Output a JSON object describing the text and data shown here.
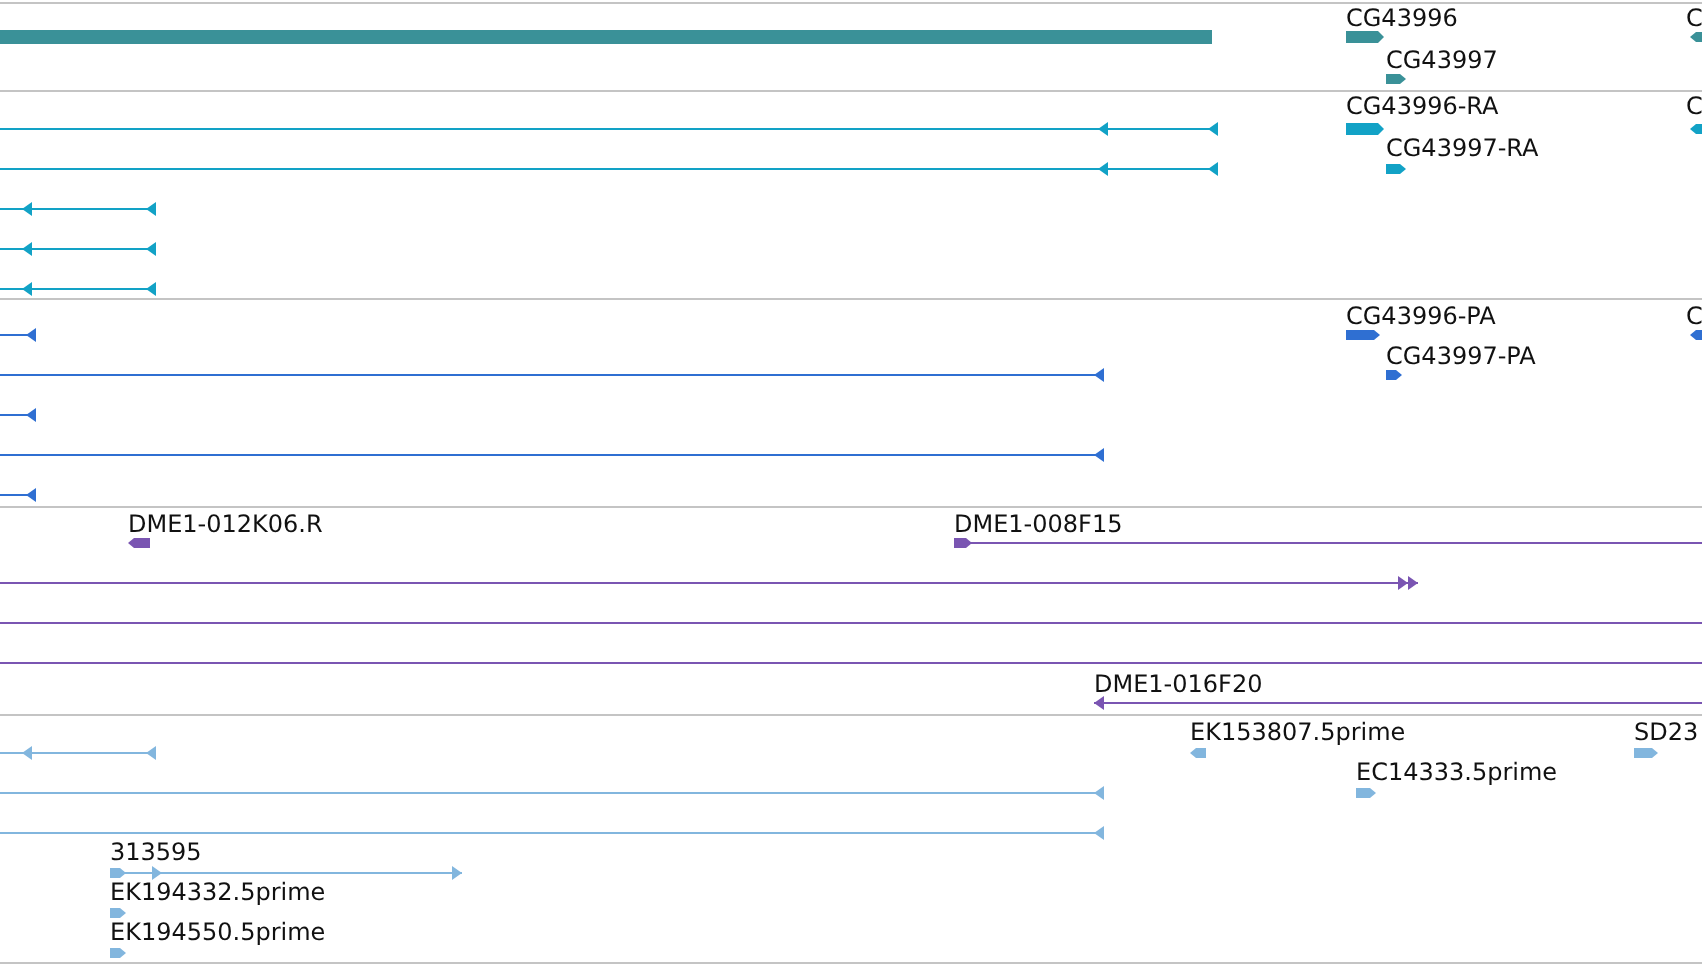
{
  "tracks": [
    {
      "color": "#3a9198",
      "features": [
        {
          "label": "CG43996",
          "kind": "forward"
        },
        {
          "label": "C",
          "kind": "reverse"
        },
        {
          "kind": "plain"
        },
        {
          "label": "CG43997",
          "kind": "forward"
        }
      ]
    },
    {
      "color": "#12a2c6",
      "features": [
        {
          "label": "CG43996-RA",
          "kind": "forward"
        },
        {
          "label": "C",
          "kind": "reverse"
        },
        {
          "kind": "reverse"
        },
        {
          "label": "CG43997-RA",
          "kind": "forward"
        },
        {
          "kind": "reverse"
        },
        {
          "kind": "reverse"
        },
        {
          "kind": "reverse"
        },
        {
          "kind": "reverse"
        }
      ]
    },
    {
      "color": "#2f6fd2",
      "features": [
        {
          "label": "CG43996-PA",
          "kind": "forward"
        },
        {
          "label": "C",
          "kind": "reverse"
        },
        {
          "kind": "reverse"
        },
        {
          "label": "CG43997-PA",
          "kind": "forward"
        },
        {
          "kind": "reverse"
        },
        {
          "kind": "reverse"
        },
        {
          "kind": "reverse"
        },
        {
          "kind": "reverse"
        }
      ]
    },
    {
      "color": "#7a55b2",
      "features": [
        {
          "label": "DME1-012K06.R",
          "kind": "reverse"
        },
        {
          "label": "DME1-008F15",
          "kind": "forward"
        },
        {
          "kind": "forward"
        },
        {
          "kind": "plain"
        },
        {
          "kind": "plain"
        },
        {
          "label": "DME1-016F20",
          "kind": "reverse"
        }
      ]
    },
    {
      "color": "#82b6de",
      "features": [
        {
          "label": "EK153807.5prime",
          "kind": "reverse"
        },
        {
          "label": "SD23",
          "kind": "forward"
        },
        {
          "kind": "reverse"
        },
        {
          "label": "EC14333.5prime",
          "kind": "forward"
        },
        {
          "kind": "reverse"
        },
        {
          "kind": "reverse"
        },
        {
          "label": "313595",
          "kind": "forward"
        },
        {
          "label": "EK194332.5prime",
          "kind": "forward"
        },
        {
          "label": "EK194550.5prime",
          "kind": "forward"
        }
      ]
    }
  ]
}
